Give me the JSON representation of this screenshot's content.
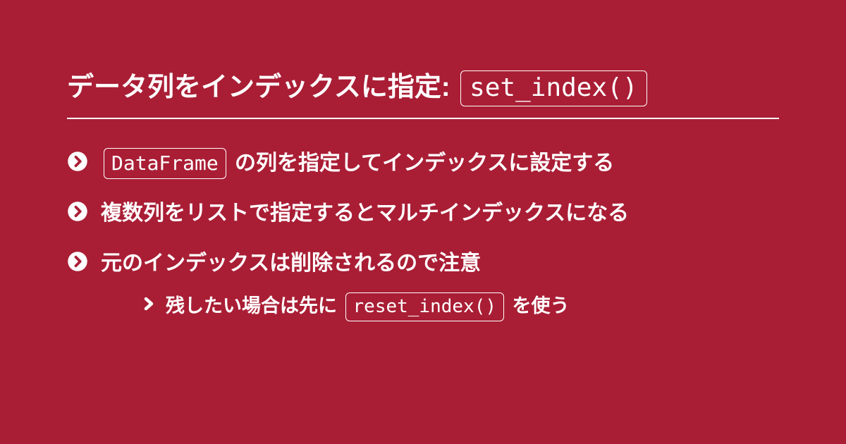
{
  "title": {
    "text_before": "データ列をインデックスに指定: ",
    "code": "set_index()"
  },
  "items": [
    {
      "parts": [
        {
          "type": "code",
          "value": "DataFrame"
        },
        {
          "type": "text",
          "value": " の列を指定してインデックスに設定する"
        }
      ]
    },
    {
      "parts": [
        {
          "type": "text",
          "value": "複数列をリストで指定するとマルチインデックスになる"
        }
      ]
    },
    {
      "parts": [
        {
          "type": "text",
          "value": "元のインデックスは削除されるので注意"
        }
      ],
      "sub": {
        "parts": [
          {
            "type": "text",
            "value": "残したい場合は先に "
          },
          {
            "type": "code",
            "value": "reset_index()"
          },
          {
            "type": "text",
            "value": " を使う"
          }
        ]
      }
    }
  ]
}
